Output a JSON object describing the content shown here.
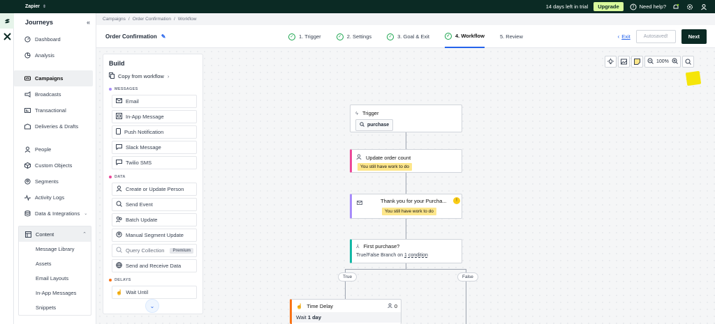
{
  "topbar": {
    "workspace": "Zapier",
    "trial_text": "14 days left in trial",
    "upgrade_label": "Upgrade",
    "help_label": "Need help?"
  },
  "sidebar": {
    "title": "Journeys",
    "items": [
      {
        "label": "Dashboard",
        "icon": "dashboard-icon"
      },
      {
        "label": "Analysis",
        "icon": "analysis-icon"
      },
      {
        "label": "Campaigns",
        "icon": "campaigns-icon",
        "active": true
      },
      {
        "label": "Broadcasts",
        "icon": "broadcast-icon"
      },
      {
        "label": "Transactional",
        "icon": "transactional-icon"
      },
      {
        "label": "Deliveries & Drafts",
        "icon": "deliveries-icon"
      },
      {
        "label": "People",
        "icon": "people-icon"
      },
      {
        "label": "Custom Objects",
        "icon": "cube-icon"
      },
      {
        "label": "Segments",
        "icon": "segments-icon"
      },
      {
        "label": "Activity Logs",
        "icon": "activity-icon"
      },
      {
        "label": "Data & Integrations",
        "icon": "database-icon"
      }
    ],
    "content_label": "Content",
    "content_items": [
      "Message Library",
      "Assets",
      "Email Layouts",
      "In-App Messages",
      "Snippets"
    ]
  },
  "breadcrumb": [
    "Campaigns",
    "Order Confirmation",
    "Workflow"
  ],
  "header": {
    "title": "Order Confirmation",
    "steps": [
      {
        "label": "1. Trigger",
        "done": true
      },
      {
        "label": "2. Settings",
        "done": true
      },
      {
        "label": "3. Goal & Exit",
        "done": true
      },
      {
        "label": "4. Workflow",
        "done": true,
        "active": true
      },
      {
        "label": "5. Review",
        "done": false
      }
    ],
    "exit_label": "Exit",
    "autosave_label": "Autosaved!",
    "next_label": "Next"
  },
  "build": {
    "title": "Build",
    "copy_label": "Copy from workflow",
    "messages_label": "MESSAGES",
    "messages": [
      "Email",
      "In-App Message",
      "Push Notification",
      "Slack Message",
      "Twilio SMS"
    ],
    "data_label": "DATA",
    "data": [
      "Create or Update Person",
      "Send Event",
      "Batch Update",
      "Manual Segment Update",
      "Query Collection",
      "Send and Receive Data"
    ],
    "premium_label": "Premium",
    "delays_label": "DELAYS",
    "delays": [
      "Wait Until"
    ],
    "colors": {
      "messages": "#a78bfa",
      "data": "#ec4899",
      "delays": "#f97316"
    }
  },
  "toolbar": {
    "zoom": "100%"
  },
  "workflow": {
    "trigger": {
      "label": "Trigger",
      "tag": "purchase"
    },
    "update": {
      "label": "Update order count",
      "warning": "You still have work to do",
      "color": "#ec4899"
    },
    "email": {
      "label": "Thank you for your Purcha...",
      "warning": "You still have work to do",
      "color": "#a78bfa"
    },
    "branch": {
      "label": "First purchase?",
      "desc_prefix": "True/False Branch on",
      "desc_link": "1 condition",
      "color": "#14b8a6"
    },
    "true_label": "True",
    "false_label": "False",
    "delay": {
      "label": "Time Delay",
      "count": "0",
      "desc_prefix": "Wait",
      "desc_value": "1 day",
      "color": "#f97316"
    }
  }
}
